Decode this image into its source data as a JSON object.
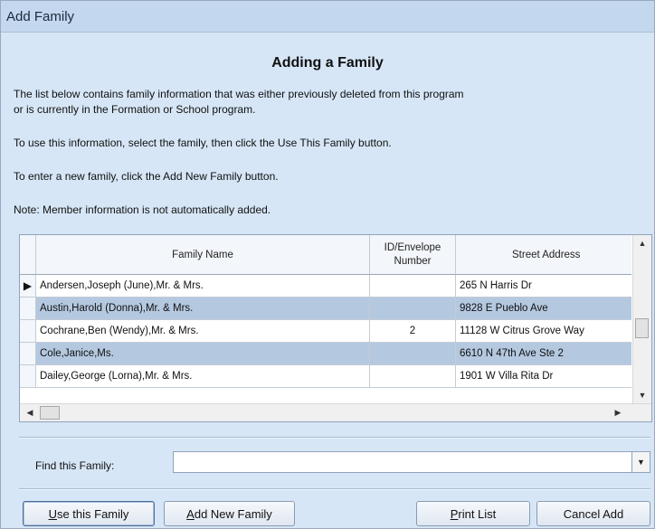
{
  "window": {
    "title": "Add Family"
  },
  "heading": "Adding a Family",
  "paragraphs": {
    "p1_line1": "The list below contains family information that was either previously deleted from this program",
    "p1_line2": "or is currently in the Formation or School program.",
    "p2": "To use this information, select the family, then click the Use This Family button.",
    "p3": "To enter a new family, click the Add New Family button.",
    "p4": "Note: Member information is not automatically added."
  },
  "grid": {
    "columns": {
      "family_name": "Family Name",
      "id_line1": "ID/Envelope",
      "id_line2": "Number",
      "street": "Street Address"
    },
    "rows": [
      {
        "name": "Andersen,Joseph (June),Mr. & Mrs.",
        "id": "",
        "street": "265 N Harris Dr",
        "current": true
      },
      {
        "name": "Austin,Harold (Donna),Mr. & Mrs.",
        "id": "",
        "street": "9828 E Pueblo Ave",
        "current": false
      },
      {
        "name": "Cochrane,Ben (Wendy),Mr. & Mrs.",
        "id": "2",
        "street": "11128 W Citrus Grove Way",
        "current": false
      },
      {
        "name": "Cole,Janice,Ms.",
        "id": "",
        "street": "6610 N 47th Ave Ste 2",
        "current": false
      },
      {
        "name": "Dailey,George (Lorna),Mr. & Mrs.",
        "id": "",
        "street": "1901 W Villa Rita Dr",
        "current": false
      }
    ],
    "current_row_marker": "▶"
  },
  "find": {
    "label": "Find this Family:",
    "value": ""
  },
  "buttons": {
    "use_u": "U",
    "use_rest": "se this Family",
    "add_u": "A",
    "add_rest": "dd New Family",
    "print_u": "P",
    "print_rest": "rint List",
    "cancel": "Cancel Add"
  },
  "icons": {
    "scroll_up": "▲",
    "scroll_down": "▼",
    "scroll_left": "◀",
    "scroll_right": "▶",
    "dropdown": "▼"
  }
}
